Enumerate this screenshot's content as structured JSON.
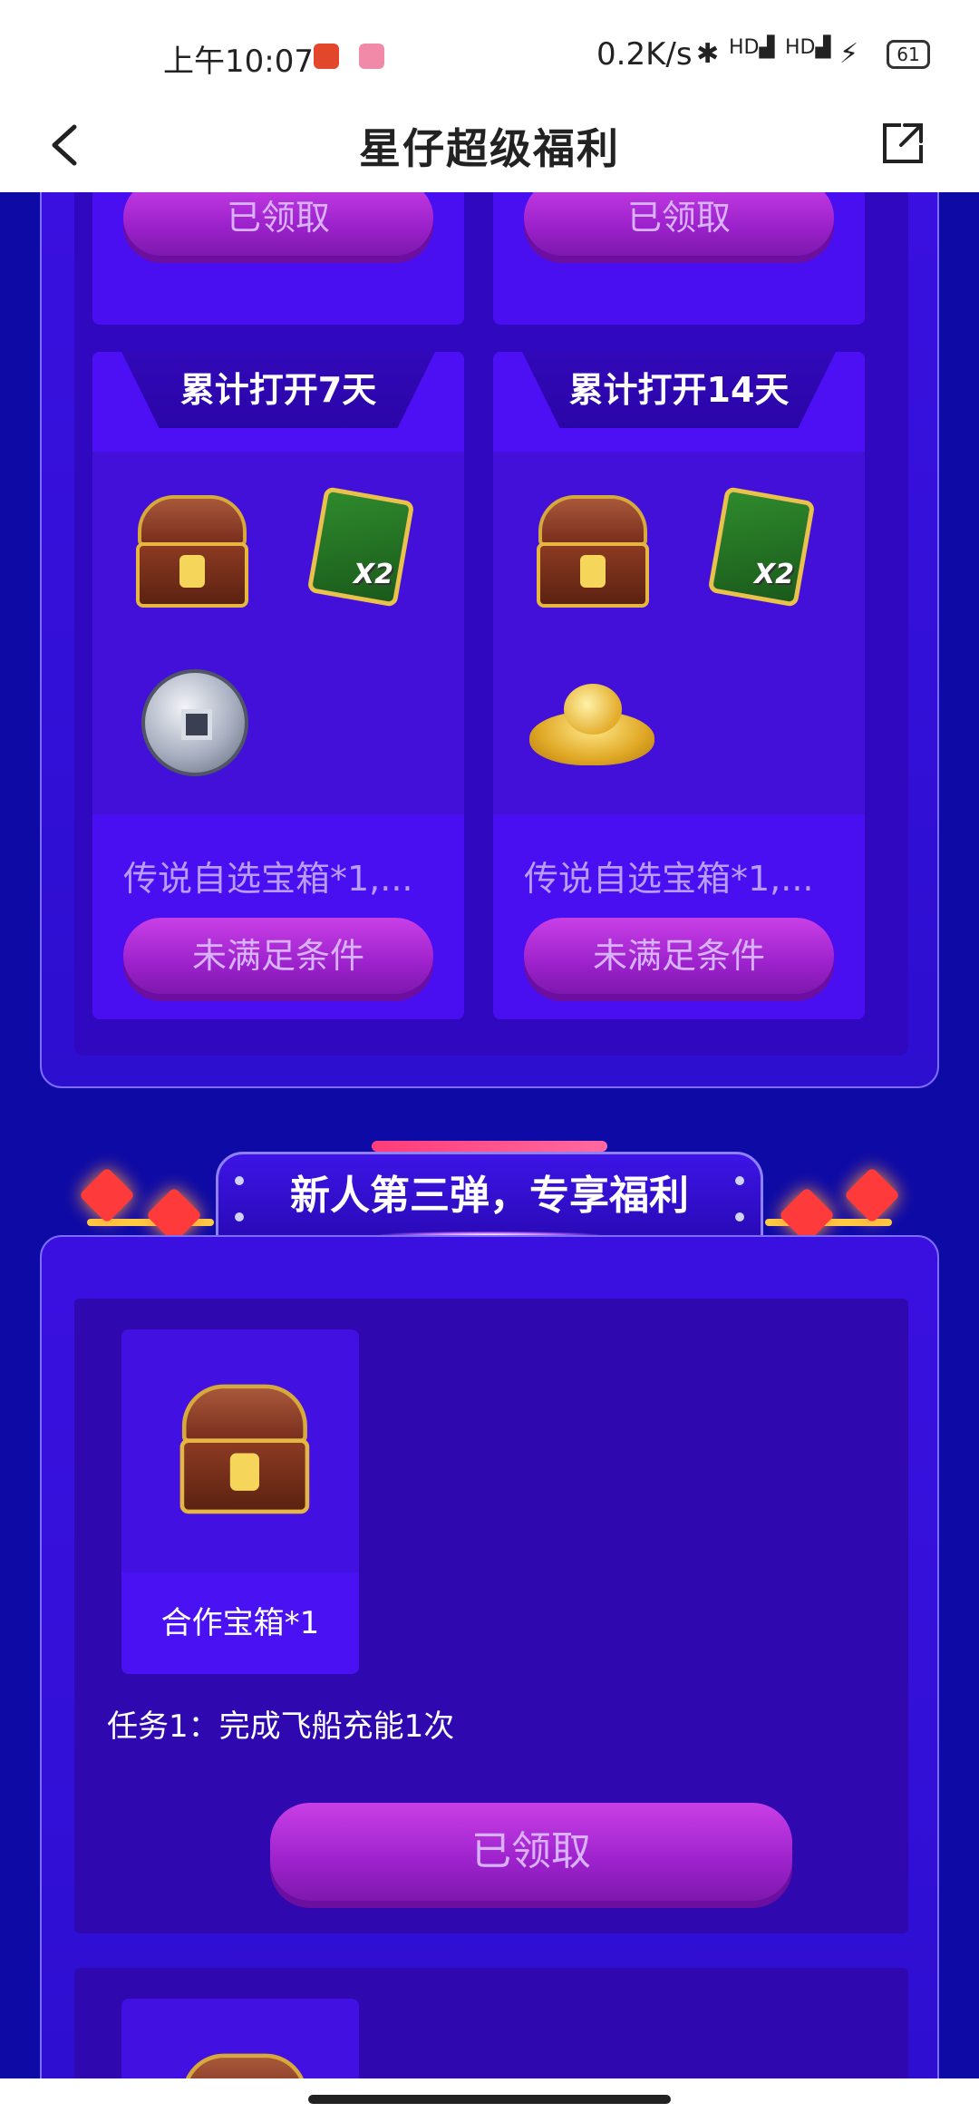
{
  "status_bar": {
    "time": "上午10:07",
    "net_speed": "0.2K/s",
    "signal1": "HD",
    "signal2": "HD",
    "battery": "61"
  },
  "header": {
    "title": "星仔超级福利"
  },
  "section2": {
    "top_cards": [
      {
        "button": "已领取"
      },
      {
        "button": "已领取"
      }
    ],
    "cards": [
      {
        "title": "累计打开7天",
        "items": [
          "treasure-chest-icon",
          "key-card-x2-icon",
          "silver-coin-icon"
        ],
        "x2_label": "X2",
        "desc": "传说自选宝箱*1,...",
        "button": "未满足条件"
      },
      {
        "title": "累计打开14天",
        "items": [
          "treasure-chest-icon",
          "key-card-x2-icon",
          "gold-ingot-icon"
        ],
        "x2_label": "X2",
        "desc": "传说自选宝箱*1,...",
        "button": "未满足条件"
      }
    ]
  },
  "section3": {
    "title": "新人第三弹，专享福利",
    "tasks": [
      {
        "reward_label": "合作宝箱*1",
        "task_text": "任务1：完成飞船充能1次",
        "button": "已领取"
      }
    ]
  }
}
